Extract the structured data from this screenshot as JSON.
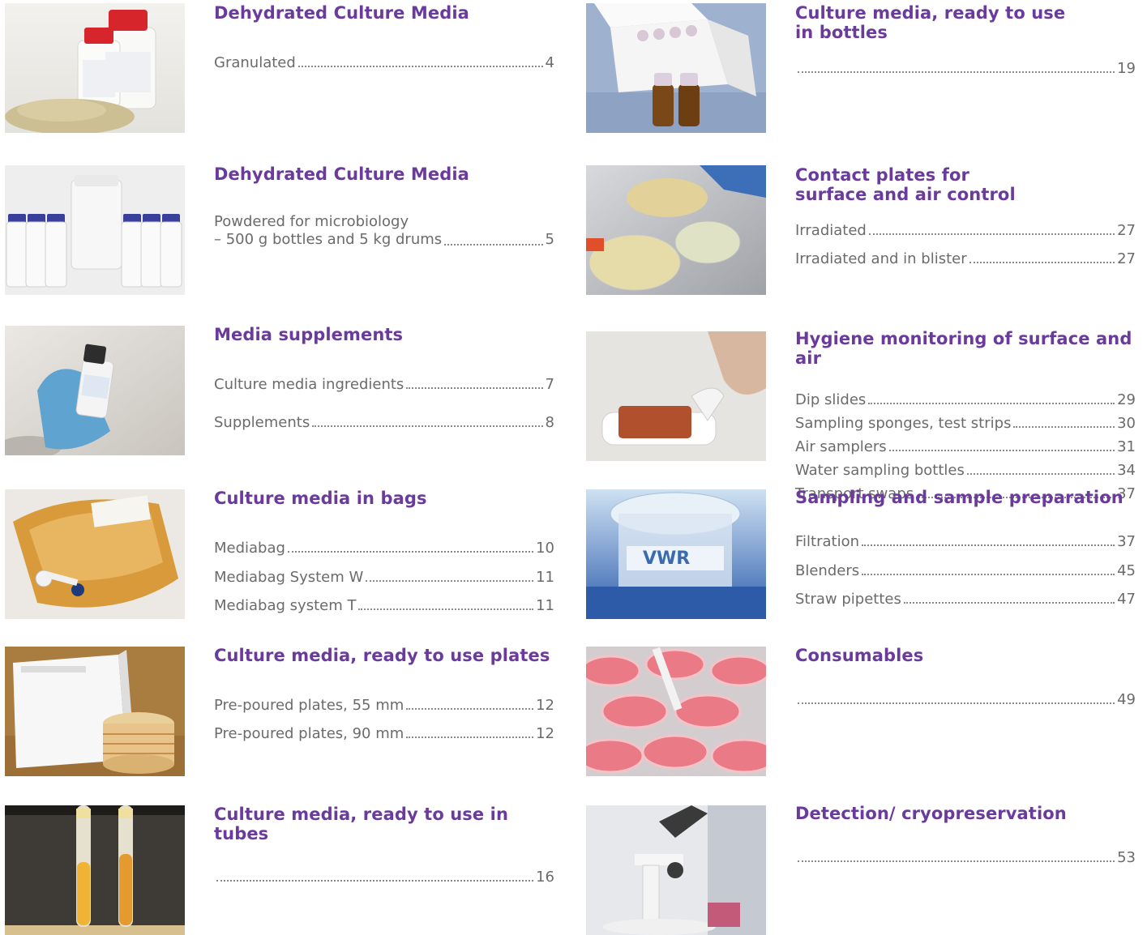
{
  "toc": {
    "left": [
      {
        "title": "Dehydrated Culture Media",
        "entries": [
          {
            "label": "Granulated",
            "page": "4"
          }
        ]
      },
      {
        "title": "Dehydrated Culture Media",
        "entries": [
          {
            "label": "Powdered for microbiology\n– 500 g bottles and 5 kg drums",
            "page": "5"
          }
        ]
      },
      {
        "title": "Media supplements",
        "entries": [
          {
            "label": "Culture media ingredients",
            "page": "7"
          },
          {
            "label": "Supplements",
            "page": "8"
          }
        ]
      },
      {
        "title": "Culture media in bags",
        "entries": [
          {
            "label": "Mediabag",
            "page": "10"
          },
          {
            "label": "Mediabag System W",
            "page": "11"
          },
          {
            "label": "Mediabag system T",
            "page": "11"
          }
        ]
      },
      {
        "title": "Culture media, ready to use plates",
        "entries": [
          {
            "label": "Pre-poured plates, 55 mm",
            "page": "12"
          },
          {
            "label": "Pre-poured plates, 90 mm",
            "page": "12"
          }
        ]
      },
      {
        "title": "Culture media, ready to use in tubes",
        "entries": [
          {
            "label": "",
            "page": "16"
          }
        ]
      }
    ],
    "right": [
      {
        "title": "Culture media, ready to use\n in bottles",
        "entries": [
          {
            "label": "",
            "page": "19"
          }
        ]
      },
      {
        "title": "Contact plates for\nsurface and air control",
        "entries": [
          {
            "label": "Irradiated",
            "page": "27"
          },
          {
            "label": "Irradiated and in blister",
            "page": "27"
          }
        ]
      },
      {
        "title": "Hygiene monitoring of surface and air",
        "entries": [
          {
            "label": "Dip slides",
            "page": "29"
          },
          {
            "label": "Sampling sponges, test strips",
            "page": "30"
          },
          {
            "label": "Air samplers",
            "page": "31"
          },
          {
            "label": "Water sampling bottles",
            "page": "34"
          },
          {
            "label": "Transport swaps",
            "page": "37"
          }
        ]
      },
      {
        "title": "Sampling and sample preparation",
        "entries": [
          {
            "label": "Filtration",
            "page": "37"
          },
          {
            "label": "Blenders",
            "page": "45"
          },
          {
            "label": "Straw pipettes",
            "page": "47"
          }
        ]
      },
      {
        "title": "Consumables",
        "entries": [
          {
            "label": "",
            "page": "49"
          }
        ]
      },
      {
        "title": "Detection/ cryopreservation",
        "entries": [
          {
            "label": "",
            "page": "53"
          }
        ]
      }
    ]
  },
  "colors": {
    "heading": "#6a3b9c",
    "text": "#6b6b6b"
  }
}
